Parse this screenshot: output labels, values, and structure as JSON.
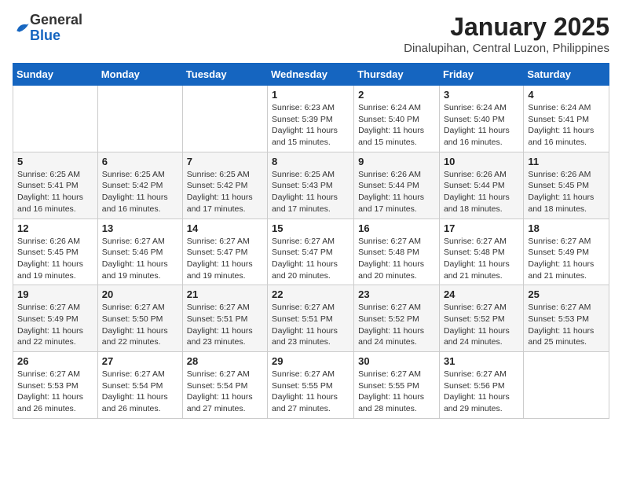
{
  "header": {
    "logo_general": "General",
    "logo_blue": "Blue",
    "title": "January 2025",
    "subtitle": "Dinalupihan, Central Luzon, Philippines"
  },
  "weekdays": [
    "Sunday",
    "Monday",
    "Tuesday",
    "Wednesday",
    "Thursday",
    "Friday",
    "Saturday"
  ],
  "weeks": [
    [
      {
        "day": "",
        "info": ""
      },
      {
        "day": "",
        "info": ""
      },
      {
        "day": "",
        "info": ""
      },
      {
        "day": "1",
        "info": "Sunrise: 6:23 AM\nSunset: 5:39 PM\nDaylight: 11 hours and 15 minutes."
      },
      {
        "day": "2",
        "info": "Sunrise: 6:24 AM\nSunset: 5:40 PM\nDaylight: 11 hours and 15 minutes."
      },
      {
        "day": "3",
        "info": "Sunrise: 6:24 AM\nSunset: 5:40 PM\nDaylight: 11 hours and 16 minutes."
      },
      {
        "day": "4",
        "info": "Sunrise: 6:24 AM\nSunset: 5:41 PM\nDaylight: 11 hours and 16 minutes."
      }
    ],
    [
      {
        "day": "5",
        "info": "Sunrise: 6:25 AM\nSunset: 5:41 PM\nDaylight: 11 hours and 16 minutes."
      },
      {
        "day": "6",
        "info": "Sunrise: 6:25 AM\nSunset: 5:42 PM\nDaylight: 11 hours and 16 minutes."
      },
      {
        "day": "7",
        "info": "Sunrise: 6:25 AM\nSunset: 5:42 PM\nDaylight: 11 hours and 17 minutes."
      },
      {
        "day": "8",
        "info": "Sunrise: 6:25 AM\nSunset: 5:43 PM\nDaylight: 11 hours and 17 minutes."
      },
      {
        "day": "9",
        "info": "Sunrise: 6:26 AM\nSunset: 5:44 PM\nDaylight: 11 hours and 17 minutes."
      },
      {
        "day": "10",
        "info": "Sunrise: 6:26 AM\nSunset: 5:44 PM\nDaylight: 11 hours and 18 minutes."
      },
      {
        "day": "11",
        "info": "Sunrise: 6:26 AM\nSunset: 5:45 PM\nDaylight: 11 hours and 18 minutes."
      }
    ],
    [
      {
        "day": "12",
        "info": "Sunrise: 6:26 AM\nSunset: 5:45 PM\nDaylight: 11 hours and 19 minutes."
      },
      {
        "day": "13",
        "info": "Sunrise: 6:27 AM\nSunset: 5:46 PM\nDaylight: 11 hours and 19 minutes."
      },
      {
        "day": "14",
        "info": "Sunrise: 6:27 AM\nSunset: 5:47 PM\nDaylight: 11 hours and 19 minutes."
      },
      {
        "day": "15",
        "info": "Sunrise: 6:27 AM\nSunset: 5:47 PM\nDaylight: 11 hours and 20 minutes."
      },
      {
        "day": "16",
        "info": "Sunrise: 6:27 AM\nSunset: 5:48 PM\nDaylight: 11 hours and 20 minutes."
      },
      {
        "day": "17",
        "info": "Sunrise: 6:27 AM\nSunset: 5:48 PM\nDaylight: 11 hours and 21 minutes."
      },
      {
        "day": "18",
        "info": "Sunrise: 6:27 AM\nSunset: 5:49 PM\nDaylight: 11 hours and 21 minutes."
      }
    ],
    [
      {
        "day": "19",
        "info": "Sunrise: 6:27 AM\nSunset: 5:49 PM\nDaylight: 11 hours and 22 minutes."
      },
      {
        "day": "20",
        "info": "Sunrise: 6:27 AM\nSunset: 5:50 PM\nDaylight: 11 hours and 22 minutes."
      },
      {
        "day": "21",
        "info": "Sunrise: 6:27 AM\nSunset: 5:51 PM\nDaylight: 11 hours and 23 minutes."
      },
      {
        "day": "22",
        "info": "Sunrise: 6:27 AM\nSunset: 5:51 PM\nDaylight: 11 hours and 23 minutes."
      },
      {
        "day": "23",
        "info": "Sunrise: 6:27 AM\nSunset: 5:52 PM\nDaylight: 11 hours and 24 minutes."
      },
      {
        "day": "24",
        "info": "Sunrise: 6:27 AM\nSunset: 5:52 PM\nDaylight: 11 hours and 24 minutes."
      },
      {
        "day": "25",
        "info": "Sunrise: 6:27 AM\nSunset: 5:53 PM\nDaylight: 11 hours and 25 minutes."
      }
    ],
    [
      {
        "day": "26",
        "info": "Sunrise: 6:27 AM\nSunset: 5:53 PM\nDaylight: 11 hours and 26 minutes."
      },
      {
        "day": "27",
        "info": "Sunrise: 6:27 AM\nSunset: 5:54 PM\nDaylight: 11 hours and 26 minutes."
      },
      {
        "day": "28",
        "info": "Sunrise: 6:27 AM\nSunset: 5:54 PM\nDaylight: 11 hours and 27 minutes."
      },
      {
        "day": "29",
        "info": "Sunrise: 6:27 AM\nSunset: 5:55 PM\nDaylight: 11 hours and 27 minutes."
      },
      {
        "day": "30",
        "info": "Sunrise: 6:27 AM\nSunset: 5:55 PM\nDaylight: 11 hours and 28 minutes."
      },
      {
        "day": "31",
        "info": "Sunrise: 6:27 AM\nSunset: 5:56 PM\nDaylight: 11 hours and 29 minutes."
      },
      {
        "day": "",
        "info": ""
      }
    ]
  ]
}
